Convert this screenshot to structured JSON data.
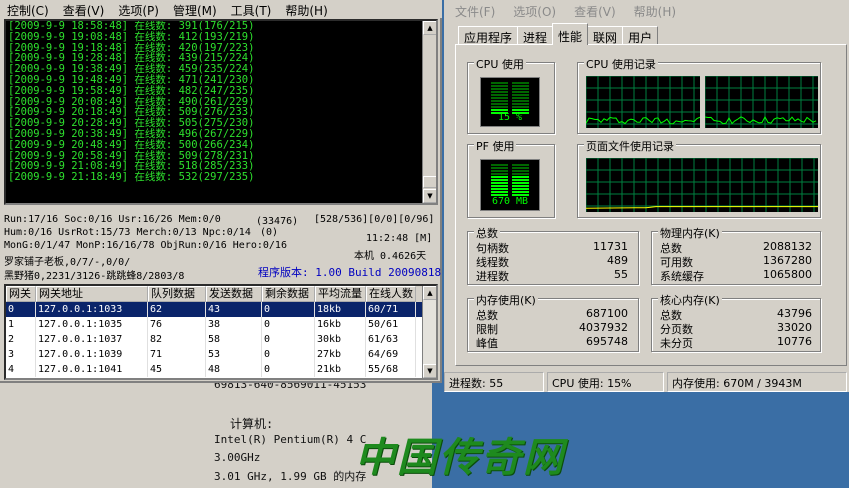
{
  "game_window": {
    "menu": [
      "控制(C)",
      "查看(V)",
      "选项(P)",
      "管理(M)",
      "工具(T)",
      "帮助(H)"
    ],
    "log": [
      "[2009-9-9 18:58:48] 在线数: 391(176/215)",
      "[2009-9-9 19:08:48] 在线数: 412(193/219)",
      "[2009-9-9 19:18:48] 在线数: 420(197/223)",
      "[2009-9-9 19:28:48] 在线数: 439(215/224)",
      "[2009-9-9 19:38:49] 在线数: 459(235/224)",
      "[2009-9-9 19:48:49] 在线数: 471(241/230)",
      "[2009-9-9 19:58:49] 在线数: 482(247/235)",
      "[2009-9-9 20:08:49] 在线数: 490(261/229)",
      "[2009-9-9 20:18:49] 在线数: 509(276/233)",
      "[2009-9-9 20:28:49] 在线数: 505(275/230)",
      "[2009-9-9 20:38:49] 在线数: 496(267/229)",
      "[2009-9-9 20:48:49] 在线数: 500(266/234)",
      "[2009-9-9 20:58:49] 在线数: 509(278/231)",
      "[2009-9-9 21:08:49] 在线数: 518(285/233)",
      "[2009-9-9 21:18:49] 在线数: 532(297/235)"
    ],
    "status": {
      "run": "Run:17/16 Soc:0/16 Usr:16/26 Mem:0/0",
      "pid": "(33476)",
      "counts": "[528/536][0/0][0/96]",
      "hum": "Hum:0/16 UsrRot:15/73 Merch:0/13 Npc:0/14",
      "zero": "(0)",
      "clock": "11:2:48 [M]",
      "mon": "MonG:0/1/47 MonP:16/16/78 ObjRun:0/16 Hero:0/16",
      "uptime": "本机 0.4626天",
      "player1": "罗家铺子老板,0/7/-,0/0/",
      "player2": "黑野猪0,2231/3126-跳跳蜂8/2803/8",
      "version": "程序版本: 1.00 Build 20090818"
    },
    "gateway_table": {
      "headers": [
        "网关",
        "网关地址",
        "队列数据",
        "发送数据",
        "剩余数据",
        "平均流量",
        "在线人数"
      ],
      "rows": [
        [
          "0",
          "127.0.0.1:1033",
          "62",
          "43",
          "0",
          "18kb",
          "60/71"
        ],
        [
          "1",
          "127.0.0.1:1035",
          "76",
          "38",
          "0",
          "16kb",
          "50/61"
        ],
        [
          "2",
          "127.0.0.1:1037",
          "82",
          "58",
          "0",
          "30kb",
          "61/63"
        ],
        [
          "3",
          "127.0.0.1:1039",
          "71",
          "53",
          "0",
          "27kb",
          "64/69"
        ],
        [
          "4",
          "127.0.0.1:1041",
          "45",
          "48",
          "0",
          "21kb",
          "55/68"
        ]
      ]
    }
  },
  "background_doc": {
    "serial_fragment": "69813-640-8569011-45153",
    "computer_label": "计算机:",
    "cpu_line": "Intel(R) Pentium(R) 4 C",
    "freq": "3.00GHz",
    "mem": "3.01 GHz, 1.99 GB 的内存"
  },
  "watermark_text": "中国传奇网",
  "task_manager": {
    "menu": [
      "文件(F)",
      "选项(O)",
      "查看(V)",
      "帮助(H)"
    ],
    "tabs": [
      "应用程序",
      "进程",
      "性能",
      "联网",
      "用户"
    ],
    "active_tab": "性能",
    "cpu_usage_title": "CPU 使用",
    "cpu_usage_value": "15 %",
    "cpu_history_title": "CPU 使用记录",
    "pf_usage_title": "PF 使用",
    "pf_usage_value": "670 MB",
    "pf_history_title": "页面文件使用记录",
    "totals": {
      "title": "总数",
      "rows": [
        [
          "句柄数",
          "11731"
        ],
        [
          "线程数",
          "489"
        ],
        [
          "进程数",
          "55"
        ]
      ]
    },
    "physical_memory": {
      "title": "物理内存(K)",
      "rows": [
        [
          "总数",
          "2088132"
        ],
        [
          "可用数",
          "1367280"
        ],
        [
          "系统缓存",
          "1065800"
        ]
      ]
    },
    "commit_charge": {
      "title": "内存使用(K)",
      "rows": [
        [
          "总数",
          "687100"
        ],
        [
          "限制",
          "4037932"
        ],
        [
          "峰值",
          "695748"
        ]
      ]
    },
    "kernel_memory": {
      "title": "核心内存(K)",
      "rows": [
        [
          "总数",
          "43796"
        ],
        [
          "分页数",
          "33020"
        ],
        [
          "未分页",
          "10776"
        ]
      ]
    },
    "statusbar": {
      "processes": "进程数: 55",
      "cpu": "CPU 使用: 15%",
      "memory": "内存使用: 670M / 3943M"
    },
    "cpu_level": 0.15,
    "graph_color": "#00ff00",
    "grid_color": "#008040"
  }
}
